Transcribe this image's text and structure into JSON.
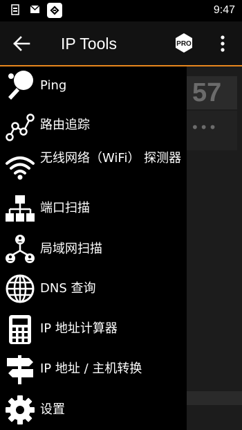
{
  "status_bar": {
    "time": "9:47",
    "icons": [
      "sim-card-icon",
      "mail-icon",
      "app-notification-icon"
    ]
  },
  "app_bar": {
    "title": "IP Tools",
    "back_icon": "arrow-back-icon",
    "pro_badge": "PRO",
    "overflow_icon": "more-vert-icon",
    "accent_color": "#e8871e"
  },
  "drawer": {
    "items": [
      {
        "label": "Ping",
        "icon": "ping-pong-paddle-icon"
      },
      {
        "label": "路由追踪",
        "icon": "route-graph-icon"
      },
      {
        "label": "无线网络（WiFi） 探测器",
        "icon": "wifi-icon"
      },
      {
        "label": "端口扫描",
        "icon": "network-ports-icon"
      },
      {
        "label": "局域网扫描",
        "icon": "lan-users-icon"
      },
      {
        "label": "DNS 查询",
        "icon": "globe-icon"
      },
      {
        "label": "IP 地址计算器",
        "icon": "calculator-icon"
      },
      {
        "label": "IP 地址 / 主机转换",
        "icon": "signpost-icon"
      },
      {
        "label": "设置",
        "icon": "gear-icon"
      }
    ]
  },
  "background": {
    "number": "57",
    "dots": "•••"
  }
}
